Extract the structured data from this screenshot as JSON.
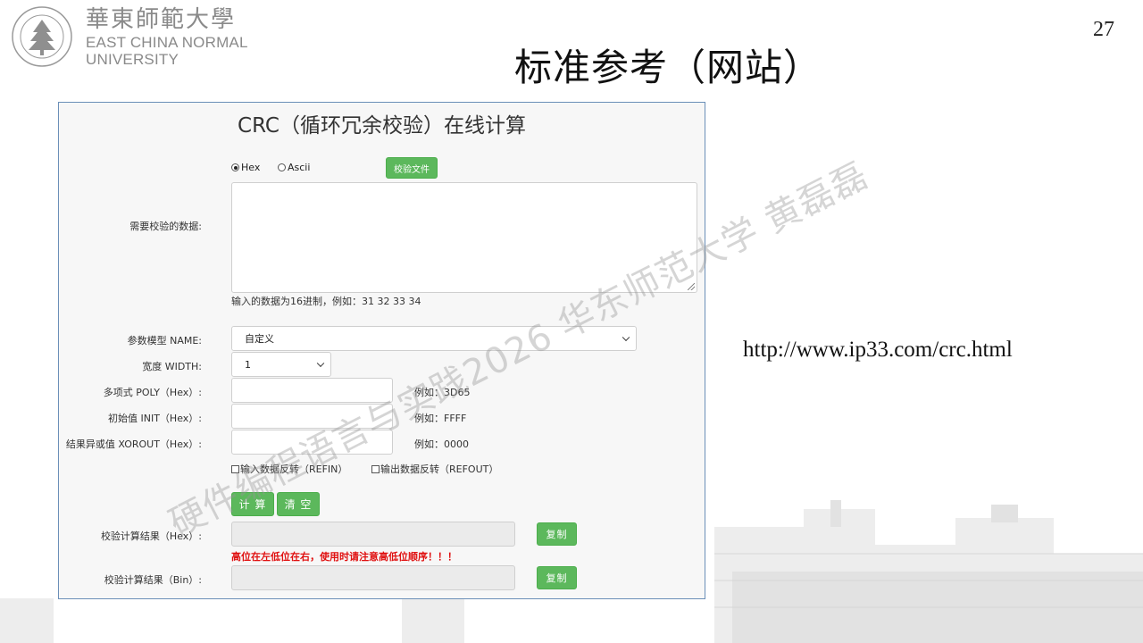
{
  "slide": {
    "page_number": "27",
    "title": "标准参考（网站）",
    "url": "http://www.ip33.com/crc.html",
    "watermark": "硬件编程语言与实践2026 华东师范大学 黄磊磊"
  },
  "logo": {
    "cn": "華東師範大學",
    "en_line1": "EAST CHINA NORMAL",
    "en_line2": "UNIVERSITY"
  },
  "crc_page": {
    "title": "CRC（循环冗余校验）在线计算",
    "format_options": [
      {
        "label": "Hex",
        "selected": true
      },
      {
        "label": "Ascii",
        "selected": false
      }
    ],
    "check_file_button": "校验文件",
    "data_label": "需要校验的数据:",
    "data_value": "",
    "data_hint": "输入的数据为16进制，例如：31 32 33 34",
    "model_label": "参数模型 NAME:",
    "model_value": "自定义",
    "width_label": "宽度 WIDTH:",
    "width_value": "1",
    "poly_label": "多项式 POLY（Hex）:",
    "poly_value": "",
    "poly_example": "例如：3D65",
    "init_label": "初始值 INIT（Hex）:",
    "init_value": "",
    "init_example": "例如：FFFF",
    "xorout_label": "结果异或值 XOROUT（Hex）:",
    "xorout_value": "",
    "xorout_example": "例如：0000",
    "refin_label": "输入数据反转（REFIN）",
    "refout_label": "输出数据反转（REFOUT）",
    "calc_button": "计 算",
    "clear_button": "清 空",
    "result_hex_label": "校验计算结果（Hex）:",
    "result_hex_value": "",
    "copy_button": "复制",
    "warning": "高位在左低位在右，使用时请注意高低位顺序！！！",
    "result_bin_label": "校验计算结果（Bin）:",
    "result_bin_value": ""
  },
  "colors": {
    "button_green": "#5cb85c",
    "warning_red": "#e01010",
    "frame_border": "#6b8fb8"
  }
}
